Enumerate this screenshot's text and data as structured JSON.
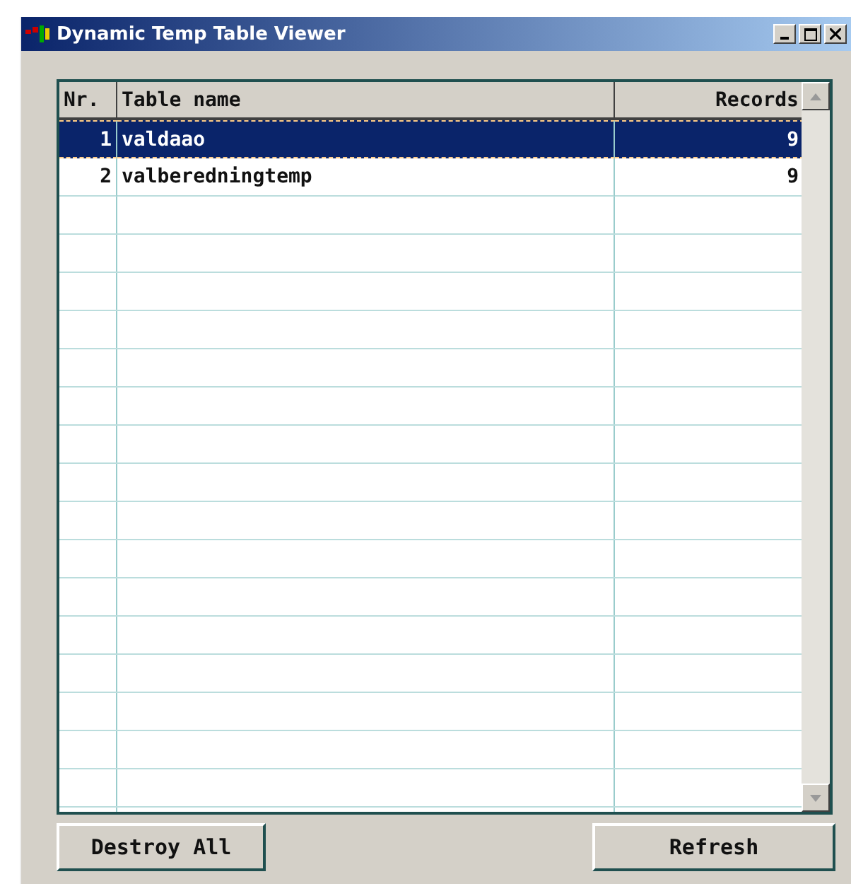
{
  "window": {
    "title": "Dynamic Temp Table Viewer"
  },
  "table": {
    "columns": [
      "Nr.",
      "Table name",
      "Records"
    ],
    "rows": [
      {
        "nr": "1",
        "name": "valdaao",
        "records": "9",
        "selected": true
      },
      {
        "nr": "2",
        "name": "valberedningtemp",
        "records": "9",
        "selected": false
      }
    ]
  },
  "buttons": [
    "Destroy All",
    "Refresh"
  ]
}
